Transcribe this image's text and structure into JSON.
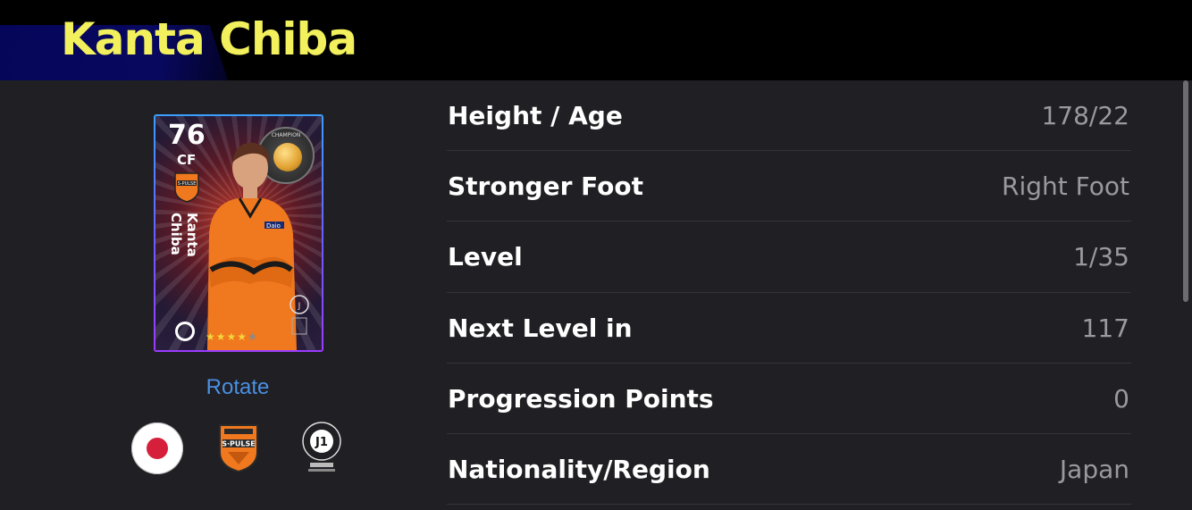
{
  "header": {
    "title": "Kanta Chiba"
  },
  "card": {
    "rating": "76",
    "position": "CF",
    "name": "Kanta Chiba",
    "medal_label": "CHAMPION",
    "stars_filled": 4,
    "stars_total": 5
  },
  "rotate_label": "Rotate",
  "icons": {
    "nationality": "japan-flag-icon",
    "club": "shimizu-s-pulse-crest-icon",
    "league": "j1-league-icon"
  },
  "stats": [
    {
      "label": "Height / Age",
      "value": "178/22"
    },
    {
      "label": "Stronger Foot",
      "value": "Right Foot"
    },
    {
      "label": "Level",
      "value": "1/35"
    },
    {
      "label": "Next Level in",
      "value": "117"
    },
    {
      "label": "Progression Points",
      "value": "0"
    },
    {
      "label": "Nationality/Region",
      "value": "Japan"
    }
  ],
  "colors": {
    "title": "#f2f05c",
    "header_bg": "#000000",
    "panel_bg": "#1f1f24",
    "link": "#4a90e2",
    "value_text": "#9a9a9e",
    "club_orange": "#f0781e"
  }
}
